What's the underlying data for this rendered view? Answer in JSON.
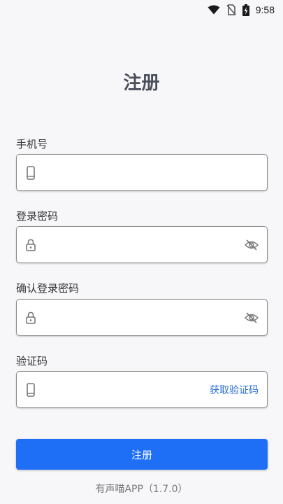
{
  "status_bar": {
    "time": "9:58"
  },
  "page": {
    "title": "注册"
  },
  "form": {
    "phone": {
      "label": "手机号",
      "value": "",
      "placeholder": ""
    },
    "password": {
      "label": "登录密码",
      "value": "",
      "placeholder": ""
    },
    "confirm_password": {
      "label": "确认登录密码",
      "value": "",
      "placeholder": ""
    },
    "verification_code": {
      "label": "验证码",
      "value": "",
      "placeholder": "",
      "get_code_label": "获取验证码"
    }
  },
  "submit": {
    "label": "注册"
  },
  "footer": {
    "app_version": "有声喵APP（1.7.0）"
  },
  "colors": {
    "primary": "#1f6ff6",
    "link": "#2c6fd6",
    "title": "#4a4f5a"
  }
}
